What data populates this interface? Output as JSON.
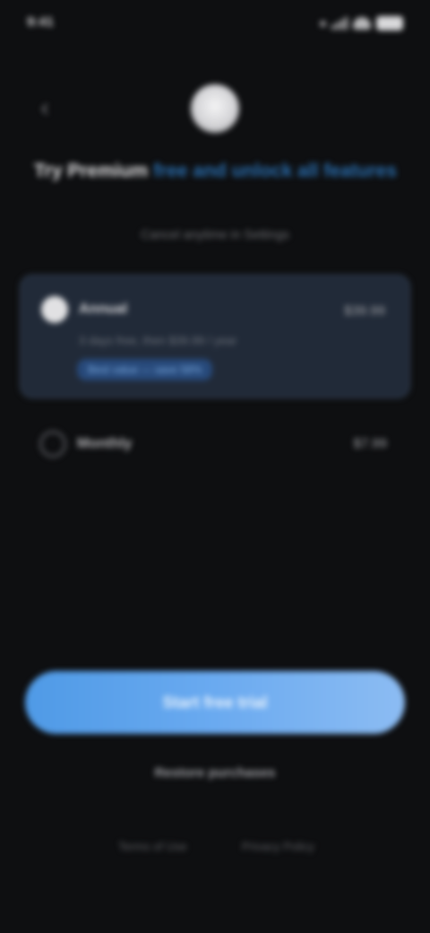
{
  "status_bar": {
    "time": "9:41",
    "icons": [
      "signal-icon",
      "wifi-icon",
      "battery-icon"
    ]
  },
  "header": {
    "back_icon": "chevron-left-icon",
    "logo_icon": "app-logo-icon"
  },
  "title": {
    "text": "Try Premium free and unlock all features",
    "highlight": "free and unlock all features"
  },
  "subtitle": "Cancel anytime in Settings",
  "options": [
    {
      "title": "Annual",
      "price": "$39.99",
      "description": "3 days free, then $39.99 / year",
      "badge": "Best value — save 58%",
      "selected": true
    },
    {
      "title": "Monthly",
      "price": "$7.99",
      "selected": false
    }
  ],
  "cta": {
    "label": "Start free trial"
  },
  "secondary": {
    "label": "Restore purchases"
  },
  "footer": {
    "terms": "Terms of Use",
    "privacy": "Privacy Policy"
  },
  "colors": {
    "background": "#0e0f11",
    "accent": "#4f9ae6",
    "card_selected": "#212a38",
    "title_highlight": "#2a6fb0"
  }
}
